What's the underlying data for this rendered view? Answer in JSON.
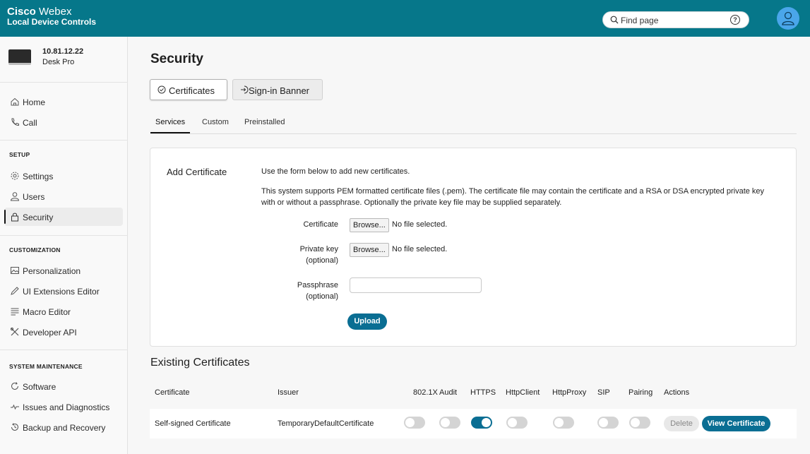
{
  "header": {
    "brand_bold": "Cisco",
    "brand_light": "Webex",
    "subtitle": "Local Device Controls",
    "search_placeholder": "Find page"
  },
  "device": {
    "ip": "10.81.12.22",
    "model": "Desk Pro"
  },
  "sidebar": {
    "main": [
      {
        "label": "Home",
        "icon": "home-icon"
      },
      {
        "label": "Call",
        "icon": "phone-icon"
      }
    ],
    "setup_label": "SETUP",
    "setup": [
      {
        "label": "Settings",
        "icon": "gear-icon"
      },
      {
        "label": "Users",
        "icon": "user-icon"
      },
      {
        "label": "Security",
        "icon": "lock-icon",
        "active": true
      }
    ],
    "customization_label": "CUSTOMIZATION",
    "customization": [
      {
        "label": "Personalization",
        "icon": "image-icon"
      },
      {
        "label": "UI Extensions Editor",
        "icon": "pencil-icon"
      },
      {
        "label": "Macro Editor",
        "icon": "lines-icon"
      },
      {
        "label": "Developer API",
        "icon": "tools-icon"
      }
    ],
    "maintenance_label": "SYSTEM MAINTENANCE",
    "maintenance": [
      {
        "label": "Software",
        "icon": "refresh-icon"
      },
      {
        "label": "Issues and Diagnostics",
        "icon": "pulse-icon"
      },
      {
        "label": "Backup and Recovery",
        "icon": "restore-icon"
      }
    ]
  },
  "main": {
    "title": "Security",
    "segments": {
      "certificates": "Certificates",
      "signin_banner": "Sign-in Banner"
    },
    "tabs": {
      "services": "Services",
      "custom": "Custom",
      "preinstalled": "Preinstalled"
    }
  },
  "add_certificate": {
    "title": "Add Certificate",
    "intro": "Use the form below to add new certificates.",
    "description": "This system supports PEM formatted certificate files (.pem). The certificate file may contain the certificate and a RSA or DSA encrypted private key with or without a passphrase. Optionally the private key file may be supplied separately.",
    "certificate_label": "Certificate",
    "private_key_label": "Private key",
    "passphrase_label": "Passphrase",
    "optional_label": "(optional)",
    "browse_label": "Browse...",
    "no_file": "No file selected.",
    "passphrase_value": "",
    "upload_label": "Upload"
  },
  "existing": {
    "title": "Existing Certificates",
    "columns": [
      "Certificate",
      "Issuer",
      "802.1X",
      "Audit",
      "HTTPS",
      "HttpClient",
      "HttpProxy",
      "SIP",
      "Pairing",
      "Actions"
    ],
    "rows": [
      {
        "certificate": "Self-signed Certificate",
        "issuer": "TemporaryDefaultCertificate",
        "toggles": {
          "802.1X": false,
          "Audit": false,
          "HTTPS": true,
          "HttpClient": false,
          "HttpProxy": false,
          "SIP": false,
          "Pairing": false
        },
        "delete_label": "Delete",
        "view_label": "View Certificate"
      }
    ]
  },
  "colors": {
    "header_bg": "#06778a",
    "accent": "#0a6e93",
    "avatar": "#4aa6ea"
  }
}
